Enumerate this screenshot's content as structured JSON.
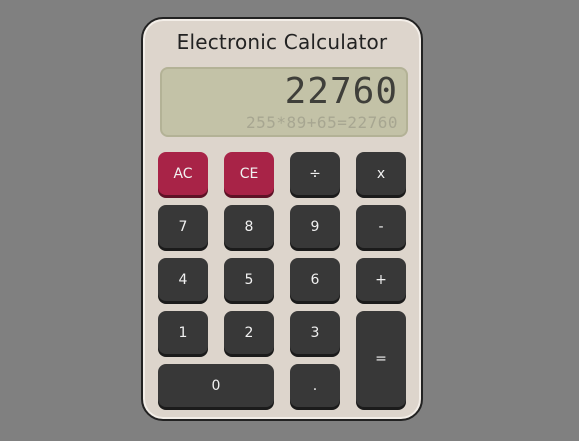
{
  "calculator": {
    "title": "Electronic Calculator",
    "display": {
      "result": "22760",
      "expression": "255*89+65=22760"
    },
    "keys": {
      "ac": "AC",
      "ce": "CE",
      "divide": "÷",
      "multiply": "x",
      "seven": "7",
      "eight": "8",
      "nine": "9",
      "minus": "-",
      "four": "4",
      "five": "5",
      "six": "6",
      "plus": "+",
      "one": "1",
      "two": "2",
      "three": "3",
      "equals": "=",
      "zero": "0",
      "decimal": "."
    },
    "colors": {
      "body": "#ddd5cc",
      "screen": "#c3c2a7",
      "key": "#383838",
      "clear_key": "#a82347"
    }
  }
}
